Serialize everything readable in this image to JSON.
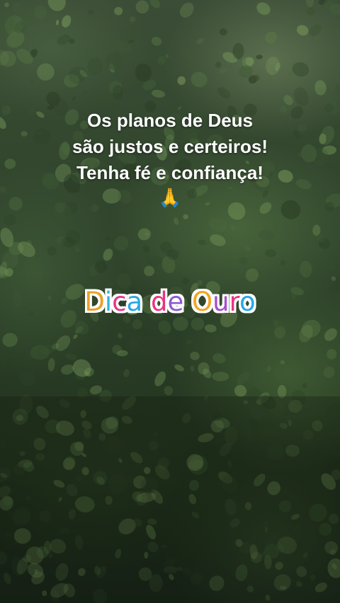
{
  "quote": {
    "line1": "Os planos de Deus",
    "line2": "são justos e certeiros!",
    "line3": "Tenha fé e confiança!",
    "emoji": "🙏"
  },
  "title": {
    "letters": [
      {
        "char": "D",
        "color": "#e8a12a"
      },
      {
        "char": "i",
        "color": "#2fb7d6"
      },
      {
        "char": "c",
        "color": "#e8368a"
      },
      {
        "char": "a",
        "color": "#2aa7e6"
      },
      {
        "char": " ",
        "color": "#ffffff"
      },
      {
        "char": "d",
        "color": "#e8367c"
      },
      {
        "char": "e",
        "color": "#8a5cd0"
      },
      {
        "char": " ",
        "color": "#ffffff"
      },
      {
        "char": "O",
        "color": "#f2a623"
      },
      {
        "char": "u",
        "color": "#a64ed0"
      },
      {
        "char": "r",
        "color": "#e8367c"
      },
      {
        "char": "o",
        "color": "#2aa7e6"
      }
    ]
  },
  "colors": {
    "text": "#ffffff",
    "foliage_dark": "#1c2a19",
    "foliage_light": "#6f8f55"
  }
}
